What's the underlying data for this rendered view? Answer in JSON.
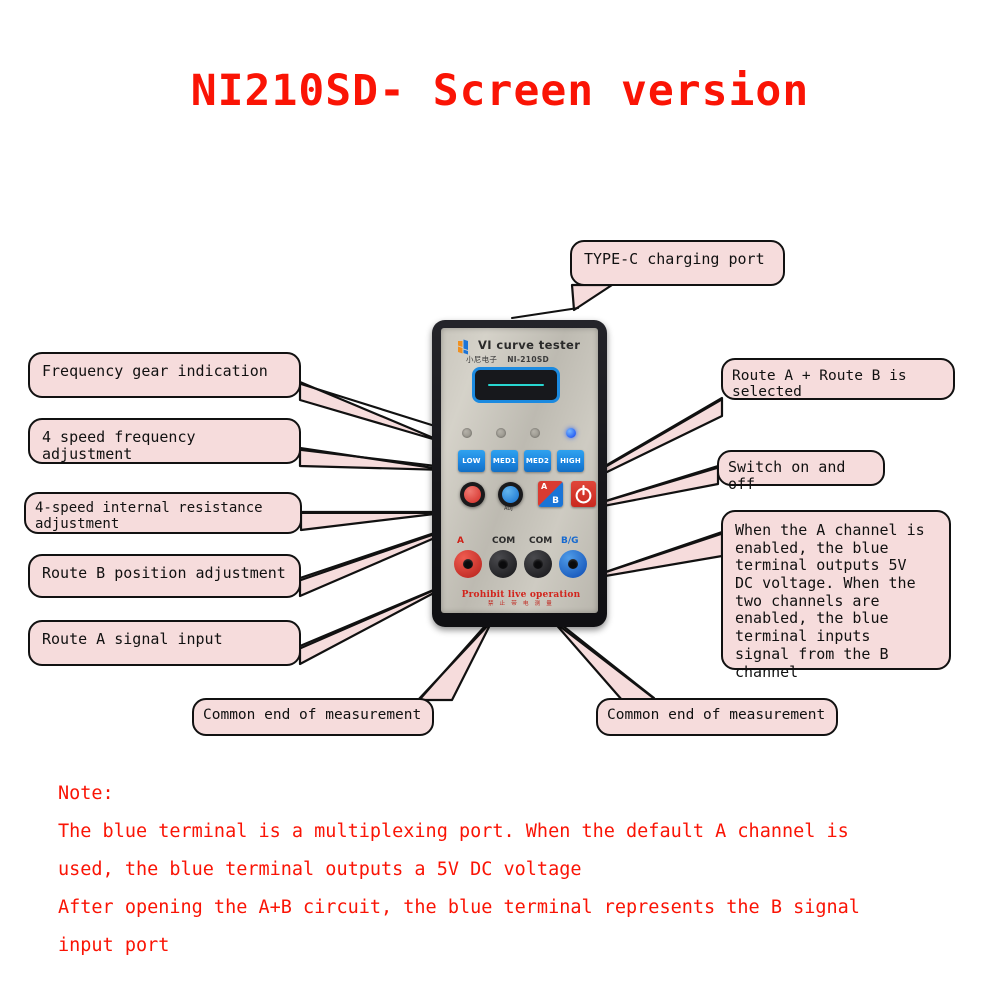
{
  "title": "NI210SD- Screen version",
  "device": {
    "brand": "VI curve tester",
    "sub_brand_cn": "小尼电子",
    "model": "NI-210SD",
    "screen_content": "",
    "leds": [
      {
        "name": "led-1",
        "state": "off"
      },
      {
        "name": "led-2",
        "state": "off"
      },
      {
        "name": "led-3",
        "state": "off"
      },
      {
        "name": "led-4",
        "state": "on"
      }
    ],
    "frequency_buttons": [
      "LOW",
      "MED1",
      "MED2",
      "HIGH"
    ],
    "knobs": [
      {
        "name": "red-knob",
        "label": ""
      },
      {
        "name": "blue-knob",
        "label": "ADJ"
      }
    ],
    "ab_button": {
      "a_label": "A",
      "b_label": "B"
    },
    "power_button_label": "",
    "jacks": [
      {
        "label": "A",
        "color": "red"
      },
      {
        "label": "COM",
        "color": "black"
      },
      {
        "label": "COM",
        "color": "black"
      },
      {
        "label": "B/G",
        "color": "blue"
      }
    ],
    "warning_en": "Prohibit live operation",
    "warning_cn": "禁 止 带 电 测 量"
  },
  "callouts": {
    "type_c": "TYPE-C charging port",
    "frequency_gear": "Frequency gear indication",
    "frequency_adjust": "4 speed frequency adjustment",
    "internal_resistance": "4-speed internal resistance adjustment",
    "route_b_position": "Route B position adjustment",
    "route_a_input": "Route A signal input",
    "route_ab_selected": "Route A + Route B is selected",
    "switch_on_off": "Switch on and off",
    "blue_terminal": "When the A channel is\nenabled, the blue\nterminal outputs 5V\nDC voltage. When the\ntwo channels are\nenabled, the blue\nterminal inputs\nsignal from the B\nchannel",
    "common_end_left": "Common end of measurement",
    "common_end_right": "Common end of measurement"
  },
  "note": {
    "heading": "Note:",
    "line1": "The blue terminal is a multiplexing port. When the default A channel is",
    "line2": "used, the blue terminal outputs a 5V DC voltage",
    "line3": "After opening the A+B circuit, the blue terminal represents the B signal",
    "line4": "input port"
  },
  "colors": {
    "title_red": "#fa1405",
    "callout_fill": "#f6dcdc",
    "callout_border": "#111111",
    "note_red": "#fa1405",
    "button_blue": "#1b83de",
    "power_red": "#c9281f",
    "led_on_blue": "#0b3df0"
  }
}
